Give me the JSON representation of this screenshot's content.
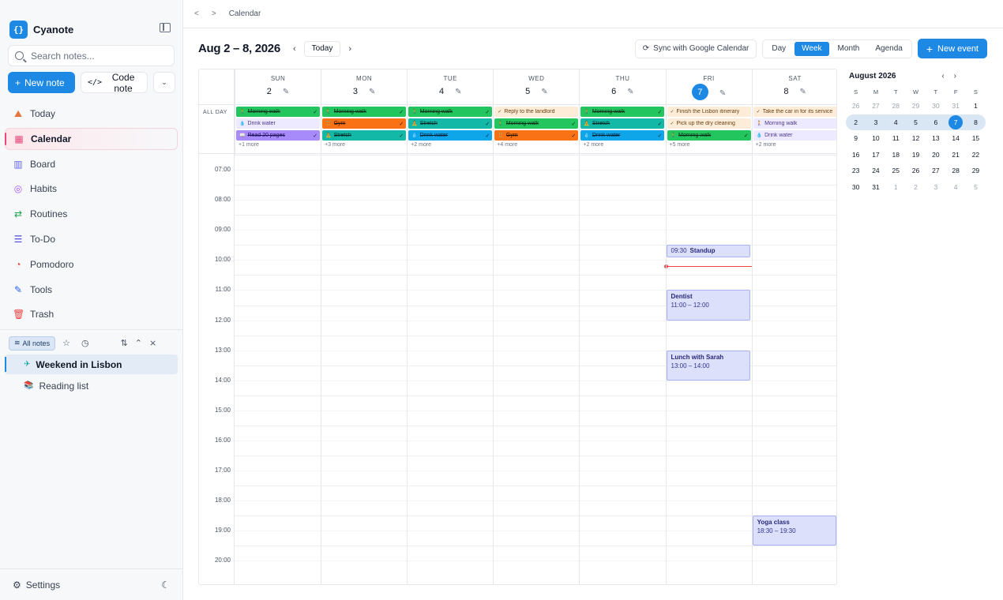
{
  "app": {
    "name": "Cyanote"
  },
  "sidebar": {
    "search_placeholder": "Search notes...",
    "new_note_label": "New note",
    "code_note_label": "Code note",
    "nav": [
      {
        "label": "Today",
        "icon": "today-icon"
      },
      {
        "label": "Calendar",
        "icon": "calendar-icon"
      },
      {
        "label": "Board",
        "icon": "board-icon"
      },
      {
        "label": "Habits",
        "icon": "habits-icon"
      },
      {
        "label": "Routines",
        "icon": "routines-icon"
      },
      {
        "label": "To-Do",
        "icon": "todo-icon"
      },
      {
        "label": "Pomodoro",
        "icon": "pomodoro-icon"
      },
      {
        "label": "Tools",
        "icon": "tools-icon"
      },
      {
        "label": "Trash",
        "icon": "trash-icon"
      }
    ],
    "all_notes_label": "All notes",
    "notes": [
      {
        "title": "Weekend in Lisbon",
        "icon": "airplane-icon"
      },
      {
        "title": "Reading list",
        "icon": "books-icon"
      }
    ],
    "settings_label": "Settings"
  },
  "breadcrumb": {
    "current": "Calendar"
  },
  "toolbar": {
    "range": "Aug 2 – 8, 2026",
    "today_label": "Today",
    "sync_label": "Sync with Google Calendar",
    "views": [
      "Day",
      "Week",
      "Month",
      "Agenda"
    ],
    "active_view": "Week",
    "new_event_label": "New event"
  },
  "calendar": {
    "all_day_label": "ALL DAY",
    "days": [
      {
        "name": "SUN",
        "num": "2",
        "today": false,
        "more": "+1 more",
        "events": [
          {
            "title": "Morning walk",
            "emoji": "🚶",
            "color": "green",
            "done": true
          },
          {
            "title": "Drink water",
            "emoji": "💧",
            "color": "lpurple",
            "done": false
          },
          {
            "title": "Read 20 pages",
            "emoji": "📖",
            "color": "purple",
            "done": true
          }
        ]
      },
      {
        "name": "MON",
        "num": "3",
        "today": false,
        "more": "+3 more",
        "events": [
          {
            "title": "Morning walk",
            "emoji": "🚶",
            "color": "green",
            "done": true
          },
          {
            "title": "Gym",
            "emoji": "🏋",
            "color": "orange",
            "done": true
          },
          {
            "title": "Stretch",
            "emoji": "🧘",
            "color": "teal",
            "done": true
          }
        ]
      },
      {
        "name": "TUE",
        "num": "4",
        "today": false,
        "more": "+2 more",
        "events": [
          {
            "title": "Morning walk",
            "emoji": "🚶",
            "color": "green",
            "done": true
          },
          {
            "title": "Stretch",
            "emoji": "🧘",
            "color": "teal",
            "done": true
          },
          {
            "title": "Drink water",
            "emoji": "💧",
            "color": "blue",
            "done": true
          }
        ]
      },
      {
        "name": "WED",
        "num": "5",
        "today": false,
        "more": "+4 more",
        "events": [
          {
            "title": "Reply to the landlord",
            "emoji": "✓",
            "color": "peach",
            "done": false
          },
          {
            "title": "Morning walk",
            "emoji": "🚶",
            "color": "green",
            "done": true
          },
          {
            "title": "Gym",
            "emoji": "🏋",
            "color": "orange",
            "done": true
          }
        ]
      },
      {
        "name": "THU",
        "num": "6",
        "today": false,
        "more": "+2 more",
        "events": [
          {
            "title": "Morning walk",
            "emoji": "🚶",
            "color": "green",
            "done": true
          },
          {
            "title": "Stretch",
            "emoji": "🧘",
            "color": "teal",
            "done": true
          },
          {
            "title": "Drink water",
            "emoji": "💧",
            "color": "blue",
            "done": true
          }
        ]
      },
      {
        "name": "FRI",
        "num": "7",
        "today": true,
        "more": "+5 more",
        "events": [
          {
            "title": "Finish the Lisbon itinerary",
            "emoji": "✓",
            "color": "peach",
            "done": false
          },
          {
            "title": "Pick up the dry cleaning",
            "emoji": "✓",
            "color": "peach",
            "done": false
          },
          {
            "title": "Morning walk",
            "emoji": "🚶",
            "color": "green",
            "done": true
          }
        ]
      },
      {
        "name": "SAT",
        "num": "8",
        "today": false,
        "more": "+2 more",
        "events": [
          {
            "title": "Take the car in for its service",
            "emoji": "✓",
            "color": "peach",
            "done": false
          },
          {
            "title": "Morning walk",
            "emoji": "🚶",
            "color": "lpurple",
            "done": false
          },
          {
            "title": "Drink water",
            "emoji": "💧",
            "color": "lpurple",
            "done": false
          }
        ]
      }
    ],
    "hours": [
      "07:00",
      "08:00",
      "09:00",
      "10:00",
      "11:00",
      "12:00",
      "13:00",
      "14:00",
      "15:00",
      "16:00",
      "17:00",
      "18:00",
      "19:00",
      "20:00"
    ],
    "timed_events": [
      {
        "day": 5,
        "start": 9.5,
        "end": 9.9,
        "time": "09:30",
        "title": "Standup",
        "inline": true
      },
      {
        "day": 5,
        "start": 11,
        "end": 12,
        "time": "11:00 – 12:00",
        "title": "Dentist",
        "inline": false
      },
      {
        "day": 5,
        "start": 13,
        "end": 14,
        "time": "13:00 – 14:00",
        "title": "Lunch with Sarah",
        "inline": false
      },
      {
        "day": 6,
        "start": 18.5,
        "end": 19.5,
        "time": "18:30 – 19:30",
        "title": "Yoga class",
        "inline": false
      }
    ],
    "now": {
      "day": 5,
      "hour": 10.2
    }
  },
  "mini_calendar": {
    "title": "August 2026",
    "weekdays": [
      "S",
      "M",
      "T",
      "W",
      "T",
      "F",
      "S"
    ],
    "weeks": [
      [
        "26",
        "27",
        "28",
        "29",
        "30",
        "31",
        "1"
      ],
      [
        "2",
        "3",
        "4",
        "5",
        "6",
        "7",
        "8"
      ],
      [
        "9",
        "10",
        "11",
        "12",
        "13",
        "14",
        "15"
      ],
      [
        "16",
        "17",
        "18",
        "19",
        "20",
        "21",
        "22"
      ],
      [
        "23",
        "24",
        "25",
        "26",
        "27",
        "28",
        "29"
      ],
      [
        "30",
        "31",
        "1",
        "2",
        "3",
        "4",
        "5"
      ]
    ],
    "selected": "7"
  }
}
